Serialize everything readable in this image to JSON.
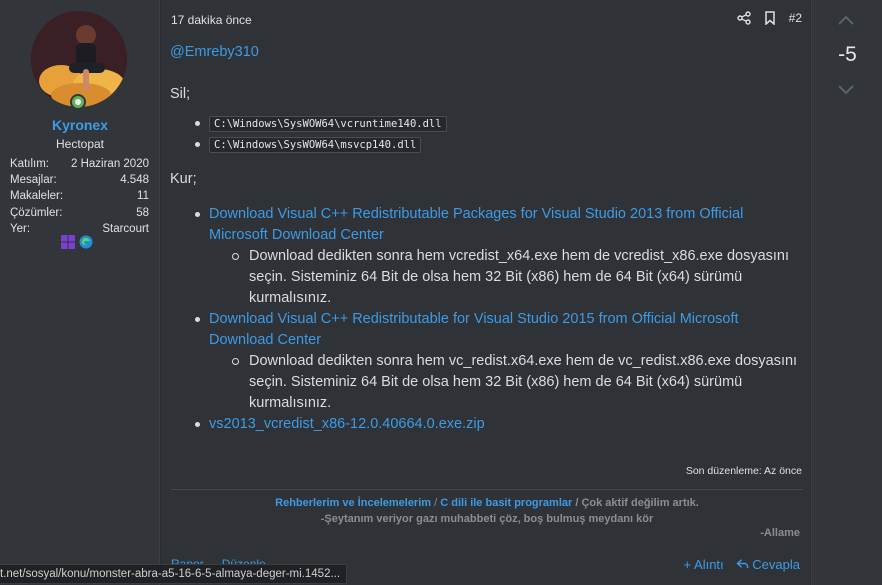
{
  "user": {
    "name": "Kyronex",
    "title": "Hectopat",
    "stats": [
      {
        "label": "Katılım:",
        "value": "2 Haziran 2020"
      },
      {
        "label": "Mesajlar:",
        "value": "4.548"
      },
      {
        "label": "Makaleler:",
        "value": "11"
      },
      {
        "label": "Çözümler:",
        "value": "58"
      },
      {
        "label": "Yer:",
        "value": "Starcourt"
      }
    ],
    "badges": [
      "windows-icon",
      "edge-icon"
    ]
  },
  "post": {
    "time": "17 dakika önce",
    "number": "#2",
    "mention": "@Emreby310",
    "sil_label": "Sil;",
    "delete_paths": [
      "C:\\Windows\\SysWOW64\\vcruntime140.dll",
      "C:\\Windows\\SysWOW64\\msvcp140.dll"
    ],
    "kur_label": "Kur;",
    "install_items": [
      {
        "link_line1": "Download Visual C++ Redistributable Packages for Visual Studio 2013 from Official",
        "link_line2": "Microsoft Download Center",
        "note_line1": "Download dedikten sonra hem vcredist_x64.exe hem de vcredist_x86.exe dosyasını",
        "note_line2": "seçin. Sisteminiz 64 Bit de olsa hem 32 Bit (x86) hem de 64 Bit (x64) sürümü",
        "note_line3": "kurmalısınız."
      },
      {
        "link_line1": "Download Visual C++ Redistributable for Visual Studio 2015 from Official Microsoft",
        "link_line2": "Download Center",
        "note_line1": "Download dedikten sonra hem vc_redist.x64.exe hem de vc_redist.x86.exe dosyasını",
        "note_line2": "seçin. Sisteminiz 64 Bit de olsa hem 32 Bit (x86) hem de 64 Bit (x64) sürümü",
        "note_line3": "kurmalısınız."
      }
    ],
    "zip_link": "vs2013_vcredist_x86-12.0.40664.0.exe.zip",
    "edited": "Son düzenleme: Az önce"
  },
  "signature": {
    "link1": "Rehberlerim ve İncelemelerim",
    "separator": "/",
    "link2": "C dili ile basit programlar",
    "status": "/ Çok aktif değilim artık.",
    "quote": "-Şeytanım veriyor gazı muhabbeti çöz, boş bulmuş meydanı kör",
    "author": "-Allame"
  },
  "footer": {
    "report": "Rapor",
    "edit": "Düzenle",
    "quote": "+ Alıntı",
    "reply": "Cevapla"
  },
  "vote": {
    "score": "-5"
  },
  "status_url": "t.net/sosyal/konu/monster-abra-a5-16-6-5-almaya-deger-mi.1452...",
  "colors": {
    "accent": "#3d9be6",
    "online": "#63b05f",
    "background": "#2a2d31"
  }
}
